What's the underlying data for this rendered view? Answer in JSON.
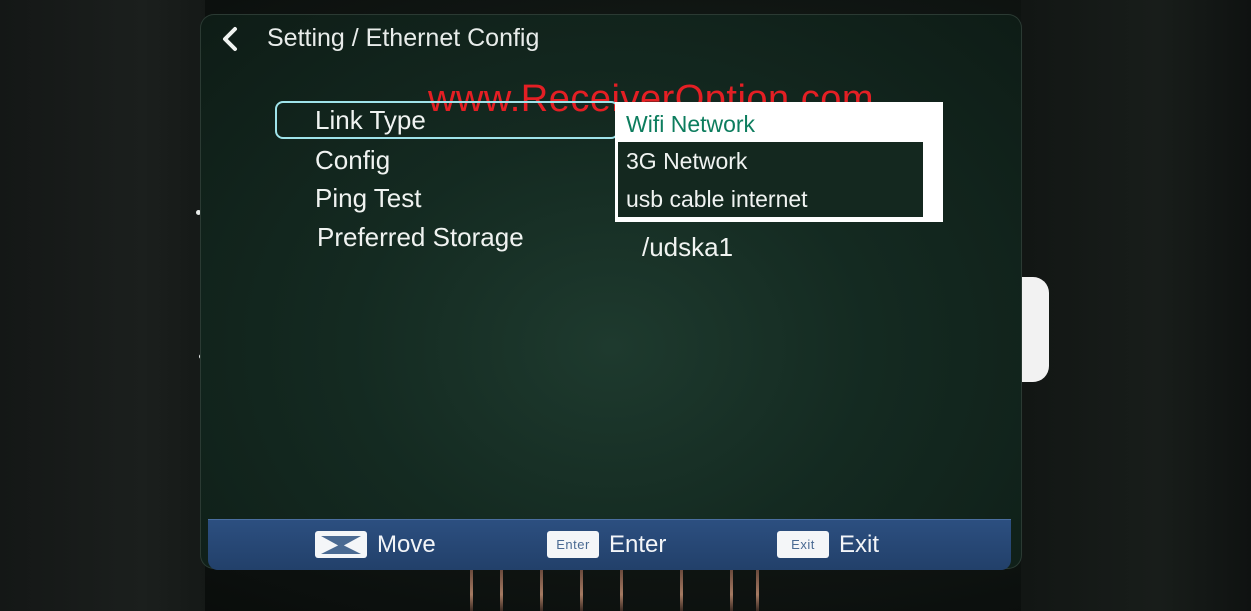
{
  "header": {
    "title": "Setting / Ethernet Config"
  },
  "watermark": "www.ReceiverOption.com",
  "menu": {
    "items": [
      {
        "label": "Link Type"
      },
      {
        "label": "Config"
      },
      {
        "label": "Ping Test"
      },
      {
        "label": "Preferred Storage"
      }
    ],
    "preferred_storage_value": "/udska1"
  },
  "dropdown": {
    "options": [
      {
        "label": "Wifi Network",
        "selected": true
      },
      {
        "label": "3G Network",
        "selected": false
      },
      {
        "label": "usb cable internet",
        "selected": false
      }
    ]
  },
  "footer": {
    "move": {
      "icon": "move-key-icon",
      "label": "Move"
    },
    "enter": {
      "icon_text": "Enter",
      "label": "Enter"
    },
    "exit": {
      "icon_text": "Exit",
      "label": "Exit"
    }
  },
  "colors": {
    "watermark": "#e41f24",
    "selection_border": "#9fe3ea",
    "dropdown_highlight_text": "#0d7d5e",
    "footer_bar": "#2c4f80"
  }
}
